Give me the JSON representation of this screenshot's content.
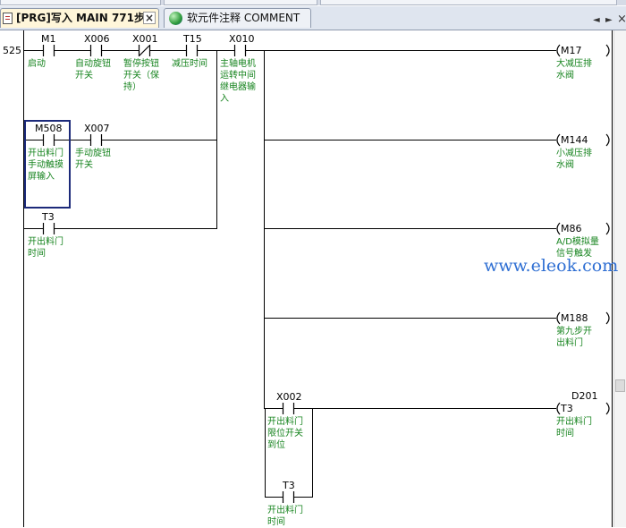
{
  "tabs": [
    {
      "label": "[PRG]写入 MAIN 771步",
      "close": "×"
    },
    {
      "label": "软元件注释 COMMENT"
    }
  ],
  "nav": {
    "prev": "◄",
    "next": "►",
    "close": "×"
  },
  "rung": {
    "number": "525"
  },
  "contacts": [
    {
      "device": "M1",
      "comment": [
        "启动"
      ]
    },
    {
      "device": "X006",
      "comment": [
        "自动旋钮",
        "开关"
      ]
    },
    {
      "device": "X001",
      "comment": [
        "暂停按钮",
        "开关（保",
        "持）"
      ]
    },
    {
      "device": "T15",
      "comment": [
        "减压时间"
      ]
    },
    {
      "device": "X010",
      "comment": [
        "主轴电机",
        "运转中间",
        "继电器输",
        "入"
      ]
    },
    {
      "device": "M508",
      "comment": [
        "开出料门",
        "手动触摸",
        "屏输入"
      ]
    },
    {
      "device": "X007",
      "comment": [
        "手动旋钮",
        "开关"
      ]
    },
    {
      "device": "T3",
      "comment": [
        "开出料门",
        "时间"
      ]
    },
    {
      "device": "X002",
      "comment": [
        "开出料门",
        "限位开关",
        "到位"
      ]
    },
    {
      "device": "T3",
      "comment": [
        "开出料门",
        "时间"
      ]
    }
  ],
  "coils": [
    {
      "device": "M17",
      "comment": [
        "大减压排",
        "水阀"
      ]
    },
    {
      "device": "M144",
      "comment": [
        "小减压排",
        "水阀"
      ]
    },
    {
      "device": "M86",
      "comment": [
        "A/D模拟量",
        "信号触发"
      ]
    },
    {
      "device": "M188",
      "comment": [
        "第九步开",
        "出料门"
      ]
    },
    {
      "device": "T3",
      "setting": "D201",
      "comment": [
        "开出料门",
        "时间"
      ]
    }
  ],
  "watermark": "www.eleok.com",
  "colors": {
    "wire": "#000000",
    "comment": "#17841f",
    "selection": "#1c2a7a",
    "watermark": "#2f6fd3",
    "active_tab": "#fff6da"
  }
}
